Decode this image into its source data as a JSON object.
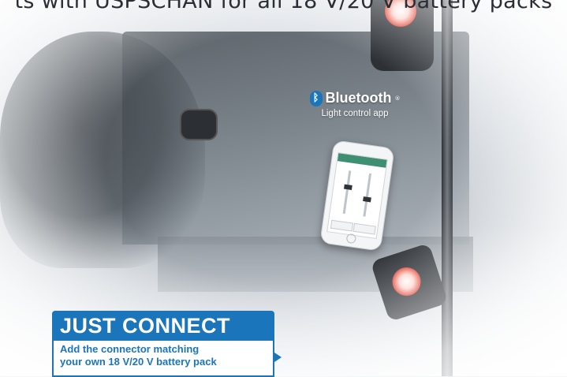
{
  "headline": "ts with USPSCHAN for all 18 V/20 V battery packs",
  "bluetooth": {
    "icon": "bluetooth-icon",
    "word": "Bluetooth",
    "registered": "®",
    "subtitle": "Light control app"
  },
  "badge": {
    "title": "JUST CONNECT",
    "line1": "Add the connector matching",
    "line2": "your own 18 V/20 V battery pack"
  },
  "colors": {
    "accent": "#1b75bb",
    "headline": "#2b2f35",
    "lamp_red": "#e34a3b"
  }
}
